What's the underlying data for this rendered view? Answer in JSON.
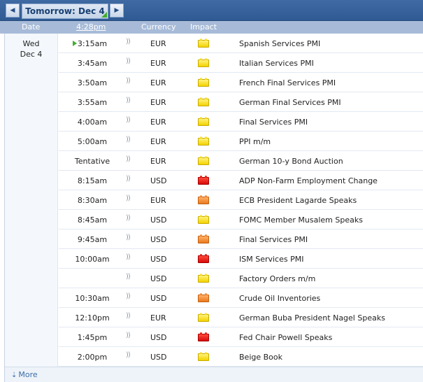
{
  "nav": {
    "prev_icon": "◀",
    "next_icon": "▶",
    "day_label": "Tomorrow: Dec 4"
  },
  "header": {
    "date": "Date",
    "time": "4:28pm",
    "currency": "Currency",
    "impact": "Impact"
  },
  "day": {
    "weekday": "Wed",
    "date": "Dec 4"
  },
  "events": [
    {
      "time": "3:15am",
      "currency": "EUR",
      "impact": "low",
      "event": "Spanish Services PMI",
      "upnext": true
    },
    {
      "time": "3:45am",
      "currency": "EUR",
      "impact": "low",
      "event": "Italian Services PMI"
    },
    {
      "time": "3:50am",
      "currency": "EUR",
      "impact": "low",
      "event": "French Final Services PMI"
    },
    {
      "time": "3:55am",
      "currency": "EUR",
      "impact": "low",
      "event": "German Final Services PMI"
    },
    {
      "time": "4:00am",
      "currency": "EUR",
      "impact": "low",
      "event": "Final Services PMI"
    },
    {
      "time": "5:00am",
      "currency": "EUR",
      "impact": "low",
      "event": "PPI m/m"
    },
    {
      "time": "Tentative",
      "currency": "EUR",
      "impact": "low",
      "event": "German 10-y Bond Auction"
    },
    {
      "time": "8:15am",
      "currency": "USD",
      "impact": "high",
      "event": "ADP Non-Farm Employment Change"
    },
    {
      "time": "8:30am",
      "currency": "EUR",
      "impact": "med",
      "event": "ECB President Lagarde Speaks"
    },
    {
      "time": "8:45am",
      "currency": "USD",
      "impact": "low",
      "event": "FOMC Member Musalem Speaks"
    },
    {
      "time": "9:45am",
      "currency": "USD",
      "impact": "med",
      "event": "Final Services PMI"
    },
    {
      "time": "10:00am",
      "currency": "USD",
      "impact": "high",
      "event": "ISM Services PMI"
    },
    {
      "time": "",
      "currency": "USD",
      "impact": "low",
      "event": "Factory Orders m/m"
    },
    {
      "time": "10:30am",
      "currency": "USD",
      "impact": "med",
      "event": "Crude Oil Inventories"
    },
    {
      "time": "12:10pm",
      "currency": "EUR",
      "impact": "low",
      "event": "German Buba President Nagel Speaks"
    },
    {
      "time": "1:45pm",
      "currency": "USD",
      "impact": "high",
      "event": "Fed Chair Powell Speaks"
    },
    {
      "time": "2:00pm",
      "currency": "USD",
      "impact": "low",
      "event": "Beige Book"
    }
  ],
  "icons": {
    "sound": "sound-icon",
    "more_arrow": "⇣"
  },
  "footer": {
    "more_label": "More"
  },
  "colors": {
    "topbar": "#2f5a93",
    "header": "#a7bbd8",
    "low": "#f3d200",
    "med": "#ea7a1e",
    "high": "#d70b0b",
    "upnext": "#3fae2e"
  }
}
